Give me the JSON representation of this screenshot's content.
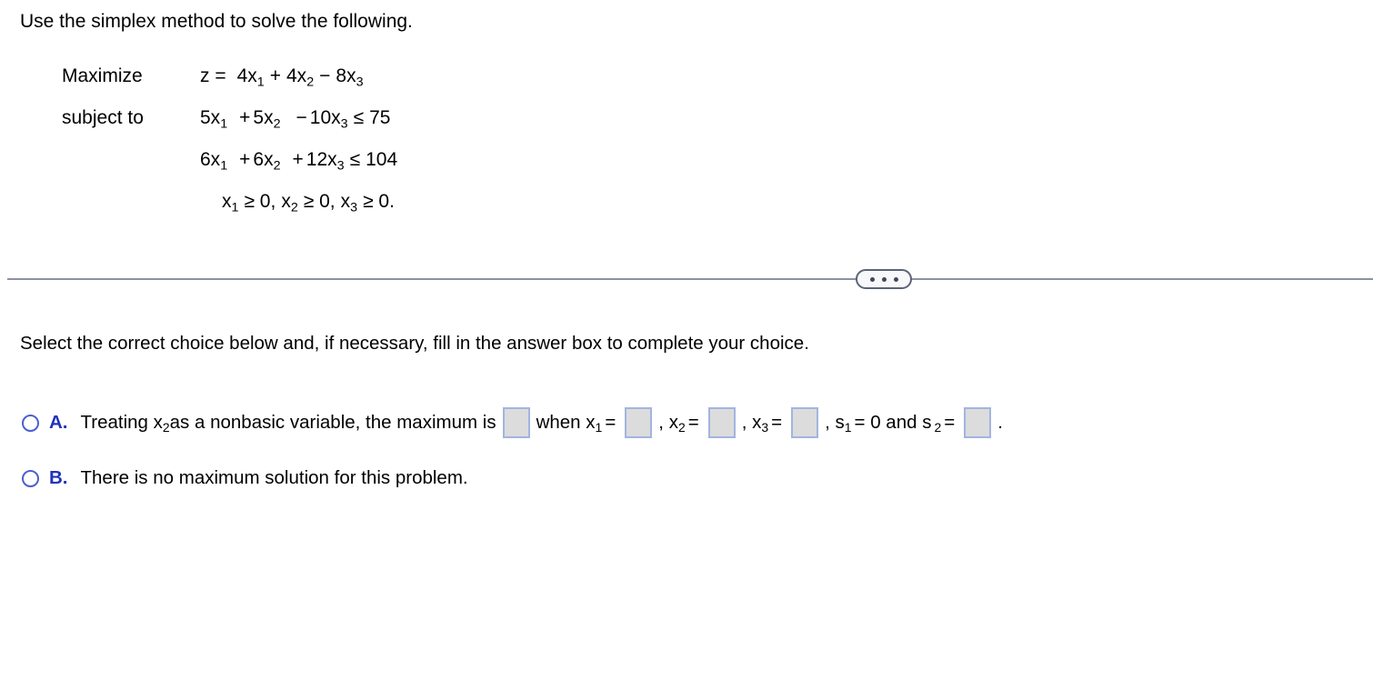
{
  "prompt": "Use the simplex method to solve the following.",
  "problem": {
    "rows": [
      {
        "label": "Maximize",
        "expr_plain": "z = 4x1 + 4x2 - 8x3",
        "parts": {
          "lhs": "z =",
          "t1_coef": "4x",
          "t1_sub": "1",
          "op1": "+",
          "t2_coef": "4x",
          "t2_sub": "2",
          "op2": "−",
          "t3_coef": "8x",
          "t3_sub": "3",
          "rel": "",
          "rhs": ""
        }
      },
      {
        "label": "subject to",
        "expr_plain": "5x1 + 5x2 - 10x3 ≤ 75",
        "parts": {
          "lhs": "",
          "t1_coef": "5x",
          "t1_sub": "1",
          "op1": "+",
          "t2_coef": "5x",
          "t2_sub": "2",
          "op2": "−",
          "t3_coef": "10x",
          "t3_sub": "3",
          "rel": "≤",
          "rhs": "75"
        }
      },
      {
        "label": "",
        "expr_plain": "6x1 + 6x2 + 12x3 ≤ 104",
        "parts": {
          "lhs": "",
          "t1_coef": "6x",
          "t1_sub": "1",
          "op1": "+",
          "t2_coef": "6x",
          "t2_sub": "2",
          "op2": "+",
          "t3_coef": "12x",
          "t3_sub": "3",
          "rel": "≤",
          "rhs": "104"
        }
      }
    ],
    "nonnegativity": {
      "v1": "x",
      "v1_sub": "1",
      "rel1": "≥ 0,",
      "v2": "x",
      "v2_sub": "2",
      "rel2": "≥ 0,",
      "v3": "x",
      "v3_sub": "3",
      "rel3": "≥ 0.",
      "plain": "x1 ≥ 0, x2 ≥ 0, x3 ≥ 0."
    }
  },
  "divider": {
    "expand_icon": "ellipsis-icon",
    "line_color": "#8b92a5",
    "pill_border_color": "#5b6477",
    "pill_fill_color": "#f7f8fa"
  },
  "instruction": "Select the correct choice below and, if necessary, fill in the answer box to complete your choice.",
  "choices": [
    {
      "letter": "A.",
      "selected": false,
      "segments": {
        "s1": "Treating x",
        "s1_sub": "2",
        "s2": " as a nonbasic variable, the maximum is",
        "s3": "when x",
        "s3_sub": "1",
        "s3_eq": "=",
        "s4": ", x",
        "s4_sub": "2",
        "s4_eq": "=",
        "s5": ", x",
        "s5_sub": "3",
        "s5_eq": "=",
        "s6": ", s",
        "s6_sub": "1",
        "s6_eq": "= 0 and s",
        "s6_sub2": "2",
        "s6_eq2": "=",
        "s7": "."
      },
      "plain": "Treating x2 as a nonbasic variable, the maximum is [ ] when x1 = [ ], x2 = [ ], x3 = [ ], s1 = 0 and s2 = [ ].",
      "answer_boxes": [
        {
          "name": "maximum-value",
          "value": ""
        },
        {
          "name": "x1-value",
          "value": ""
        },
        {
          "name": "x2-value",
          "value": ""
        },
        {
          "name": "x3-value",
          "value": ""
        },
        {
          "name": "s2-value",
          "value": ""
        }
      ]
    },
    {
      "letter": "B.",
      "selected": false,
      "plain": "There is no maximum solution for this problem.",
      "answer_boxes": []
    }
  ],
  "colors": {
    "choice_letter": "#2133bb",
    "radio_border": "#4a5fd0",
    "answer_box_border": "#a3b4e0",
    "answer_box_fill": "#dcdcdc",
    "divider": "#8b92a5",
    "background": "#ffffff",
    "text": "#000000"
  }
}
